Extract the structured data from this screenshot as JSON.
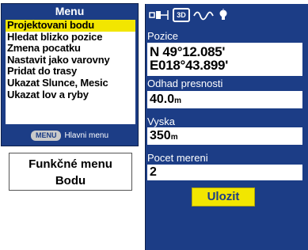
{
  "menu": {
    "title": "Menu",
    "items": [
      {
        "label": "Projektovani bodu",
        "selected": true
      },
      {
        "label": "Hledat blizko pozice"
      },
      {
        "label": "Zmena pocatku"
      },
      {
        "label": "Nastavit jako varovny"
      },
      {
        "label": "Pridat do trasy"
      },
      {
        "label": "Ukazat Slunce, Mesic"
      },
      {
        "label": "Ukazat lov a ryby"
      }
    ],
    "footer_key": "MENU",
    "footer_text": "Hlavni menu"
  },
  "caption": {
    "line1": "Funkčné menu",
    "line2": "Bodu"
  },
  "position": {
    "status_3d": "3D",
    "pozice_label": "Pozice",
    "lat": "N  49°12.085'",
    "lon": "E018°43.899'",
    "accuracy_label": "Odhad presnosti",
    "accuracy_value": "40.0",
    "accuracy_unit": "m",
    "altitude_label": "Vyska",
    "altitude_value": "350",
    "altitude_unit": "m",
    "count_label": "Pocet mereni",
    "count_value": "2",
    "save_label": "Ulozit"
  },
  "colors": {
    "screen_bg": "#1c3d86",
    "highlight": "#f2e600",
    "button": "#f2e600"
  }
}
